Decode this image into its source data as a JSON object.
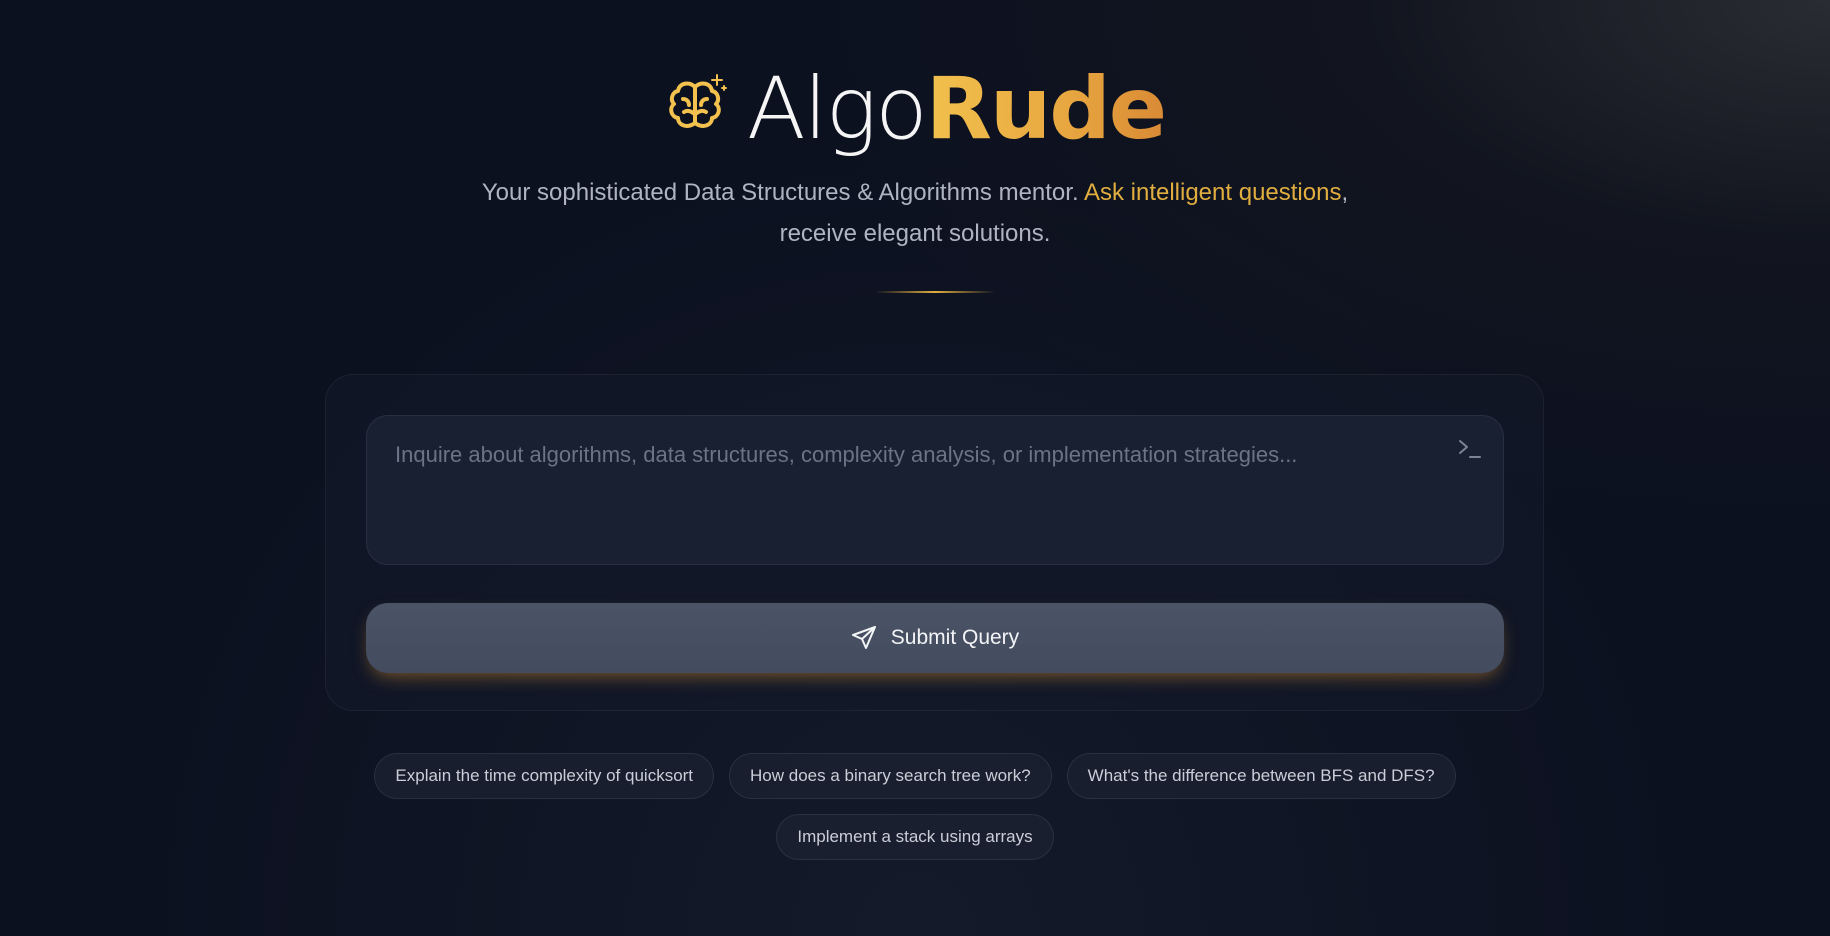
{
  "brand": {
    "name_part1": "Algo",
    "name_part2": "Rude",
    "icon": "brain-sparkle-icon",
    "accent_color": "#e0ad3f"
  },
  "tagline": {
    "before": "Your sophisticated Data Structures & Algorithms mentor. ",
    "accent": "Ask intelligent questions",
    "after": ", receive elegant solutions."
  },
  "query": {
    "placeholder": "Inquire about algorithms, data structures, complexity analysis, or implementation strategies...",
    "value": "",
    "icon": "terminal-icon"
  },
  "submit": {
    "label": "Submit Query",
    "icon": "send-icon"
  },
  "suggestions": [
    "Explain the time complexity of quicksort",
    "How does a binary search tree work?",
    "What's the difference between BFS and DFS?",
    "Implement a stack using arrays"
  ],
  "colors": {
    "background": "#0c111f",
    "button": "#454e60",
    "button_glow": "#e09632"
  }
}
